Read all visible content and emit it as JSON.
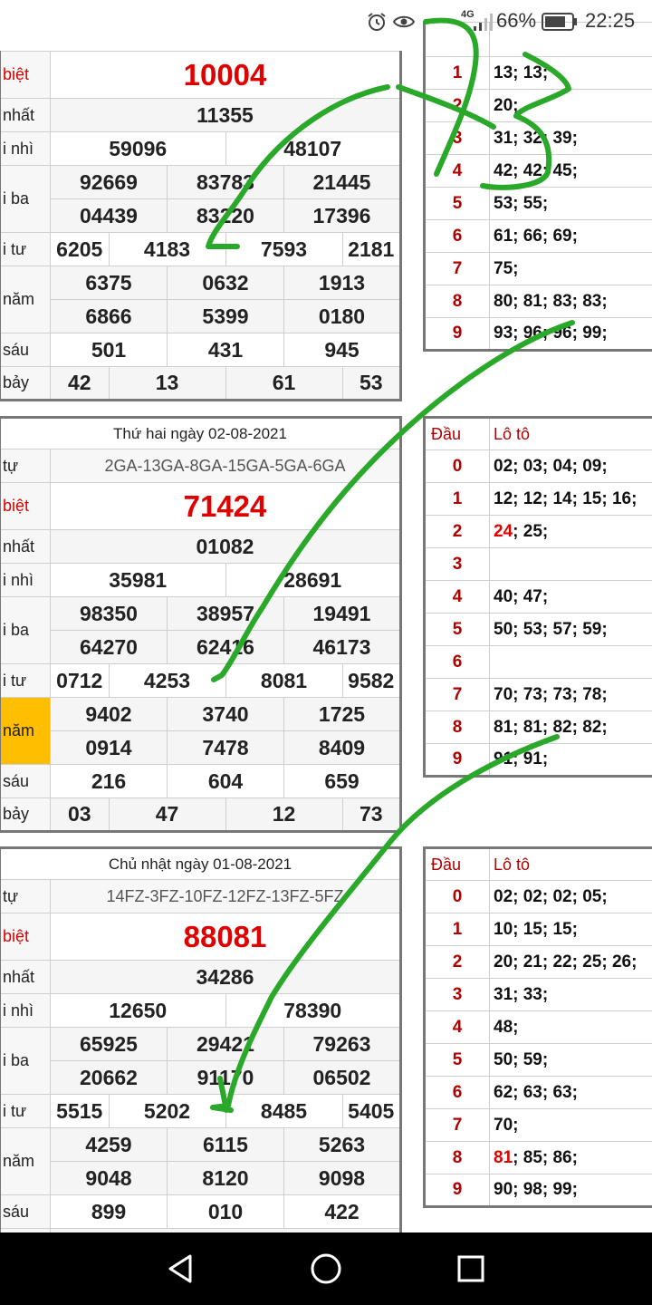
{
  "status_bar": {
    "battery": "66%",
    "network": "4G",
    "time": "22:25",
    "icons": [
      "alarm-icon",
      "eye-icon",
      "signal-icon",
      "battery-icon"
    ]
  },
  "draw_1": {
    "rows": [
      {
        "label": "biệt",
        "values": [
          "10004"
        ]
      },
      {
        "label": "nhất",
        "values": [
          "11355"
        ]
      },
      {
        "label": "i nhì",
        "values": [
          "59096",
          "48107"
        ]
      },
      {
        "label": "i ba",
        "values": [
          "92669",
          "83783",
          "21445",
          "04439",
          "83220",
          "17396"
        ]
      },
      {
        "label": "i tư",
        "values": [
          "6205",
          "4183",
          "7593",
          "2181"
        ]
      },
      {
        "label": "năm",
        "values": [
          "6375",
          "0632",
          "1913",
          "6866",
          "5399",
          "0180"
        ]
      },
      {
        "label": "sáu",
        "values": [
          "501",
          "431",
          "945"
        ]
      },
      {
        "label": "bảy",
        "values": [
          "42",
          "13",
          "61",
          "53"
        ]
      }
    ]
  },
  "loto_1": {
    "rows": [
      {
        "dau": "1",
        "value": "13; 13;"
      },
      {
        "dau": "2",
        "value": "20;"
      },
      {
        "dau": "3",
        "value": "31; 32; 39;"
      },
      {
        "dau": "4",
        "value": "42; 42; 45;"
      },
      {
        "dau": "5",
        "value": "53; 55;"
      },
      {
        "dau": "6",
        "value": "61; 66; 69;"
      },
      {
        "dau": "7",
        "value": "75;"
      },
      {
        "dau": "8",
        "value": "80; 81; 83; 83;"
      },
      {
        "dau": "9",
        "value": "93; 96; 96; 99;"
      }
    ]
  },
  "draw_2": {
    "date": "Thứ hai ngày 02-08-2021",
    "code_label": "tự",
    "code": "2GA-13GA-8GA-15GA-5GA-6GA",
    "rows": [
      {
        "label": "biệt",
        "values": [
          "71424"
        ]
      },
      {
        "label": "nhất",
        "values": [
          "01082"
        ]
      },
      {
        "label": "i nhì",
        "values": [
          "35981",
          "28691"
        ]
      },
      {
        "label": "i ba",
        "values": [
          "98350",
          "38957",
          "19491",
          "64270",
          "62416",
          "46173"
        ]
      },
      {
        "label": "i tư",
        "values": [
          "0712",
          "4253",
          "8081",
          "9582"
        ]
      },
      {
        "label": "năm",
        "values": [
          "9402",
          "3740",
          "1725",
          "0914",
          "7478",
          "8409"
        ]
      },
      {
        "label": "sáu",
        "values": [
          "216",
          "604",
          "659"
        ]
      },
      {
        "label": "bảy",
        "values": [
          "03",
          "47",
          "12",
          "73"
        ]
      }
    ]
  },
  "loto_2": {
    "header_dau": "Đầu",
    "header_loto": "Lô tô",
    "rows": [
      {
        "dau": "0",
        "value": "02; 03; 04; 09;"
      },
      {
        "dau": "1",
        "value": "12; 12; 14; 15; 16;"
      },
      {
        "dau": "2",
        "value_red": "24",
        "value": "; 25;"
      },
      {
        "dau": "3",
        "value": ""
      },
      {
        "dau": "4",
        "value": "40; 47;"
      },
      {
        "dau": "5",
        "value": "50; 53; 57; 59;"
      },
      {
        "dau": "6",
        "value": ""
      },
      {
        "dau": "7",
        "value": "70; 73; 73; 78;"
      },
      {
        "dau": "8",
        "value": "81; 81; 82; 82;"
      },
      {
        "dau": "9",
        "value": "91; 91;"
      }
    ]
  },
  "draw_3": {
    "date": "Chủ nhật ngày 01-08-2021",
    "code_label": "tự",
    "code": "14FZ-3FZ-10FZ-12FZ-13FZ-5FZ",
    "rows": [
      {
        "label": "biệt",
        "values": [
          "88081"
        ]
      },
      {
        "label": "nhất",
        "values": [
          "34286"
        ]
      },
      {
        "label": "i nhì",
        "values": [
          "12650",
          "78390"
        ]
      },
      {
        "label": "i ba",
        "values": [
          "65925",
          "29421",
          "79263",
          "20662",
          "91170",
          "06502"
        ]
      },
      {
        "label": "i tư",
        "values": [
          "5515",
          "5202",
          "8485",
          "5405"
        ]
      },
      {
        "label": "năm",
        "values": [
          "4259",
          "6115",
          "5263",
          "9048",
          "8120",
          "9098"
        ]
      },
      {
        "label": "sáu",
        "values": [
          "899",
          "010",
          "422"
        ]
      }
    ]
  },
  "loto_3": {
    "header_dau": "Đầu",
    "header_loto": "Lô tô",
    "rows": [
      {
        "dau": "0",
        "value": "02; 02; 02; 05;"
      },
      {
        "dau": "1",
        "value": "10; 15; 15;"
      },
      {
        "dau": "2",
        "value": "20; 21; 22; 25; 26;"
      },
      {
        "dau": "3",
        "value": "31; 33;"
      },
      {
        "dau": "4",
        "value": "48;"
      },
      {
        "dau": "5",
        "value": "50; 59;"
      },
      {
        "dau": "6",
        "value": "62; 63; 63;"
      },
      {
        "dau": "7",
        "value": "70;"
      },
      {
        "dau": "8",
        "value_red": "81",
        "value": "; 85; 86;"
      },
      {
        "dau": "9",
        "value": "90; 98; 99;"
      }
    ]
  },
  "nav_bar": {
    "buttons": [
      "back-button",
      "home-button",
      "recents-button"
    ]
  }
}
